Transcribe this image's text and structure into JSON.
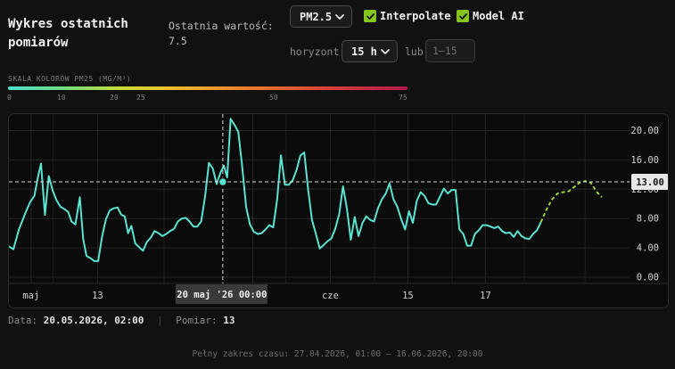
{
  "header": {
    "title": "Wykres ostatnich pomiarów",
    "last_label": "Ostatnia wartość:",
    "last_value": "7.5"
  },
  "controls": {
    "metric": "PM2.5",
    "interpolate_label": "Interpolate",
    "interpolate_checked": true,
    "model_label": "Model AI",
    "model_checked": true,
    "horizon_label": "horyzont",
    "horizon_value": "15 h",
    "or_label": "lub",
    "range_placeholder": "1–15"
  },
  "scale": {
    "title": "SKALA KOLORÓW PM25 (MG/M³)",
    "ticks": [
      "0",
      "10",
      "20",
      "25",
      "50",
      "75"
    ]
  },
  "colors": {
    "line": "#59e3d1",
    "forecast": "#9bd23e",
    "background": "#111111",
    "panel": "#0b0b0b"
  },
  "chart_data": {
    "type": "line",
    "ylim": [
      0,
      22
    ],
    "y_ticks": [
      "0.00",
      "4.00",
      "8.00",
      "12.00",
      "16.00",
      "20.00"
    ],
    "x_labels": [
      {
        "label": "maj",
        "x": 4
      },
      {
        "label": "13",
        "x": 16
      },
      {
        "label": "27",
        "x": 44
      },
      {
        "label": "cze",
        "x": 58
      },
      {
        "label": "15",
        "x": 72
      },
      {
        "label": "17",
        "x": 86
      }
    ],
    "series": [
      {
        "values": [
          [
            0,
            4.2
          ],
          [
            0.8,
            3.8
          ],
          [
            1.8,
            6.5
          ],
          [
            3,
            8.8
          ],
          [
            3.8,
            10.2
          ],
          [
            4.6,
            11.1
          ],
          [
            5.2,
            13.5
          ],
          [
            5.8,
            15.5
          ],
          [
            6.5,
            8.5
          ],
          [
            7.2,
            13.8
          ],
          [
            7.9,
            11.8
          ],
          [
            8.6,
            10.5
          ],
          [
            9.3,
            9.6
          ],
          [
            10,
            9.3
          ],
          [
            10.7,
            8.9
          ],
          [
            11.3,
            7.6
          ],
          [
            12,
            7.2
          ],
          [
            12.8,
            10.9
          ],
          [
            13.4,
            5.2
          ],
          [
            14,
            2.9
          ],
          [
            14.7,
            2.6
          ],
          [
            15.4,
            2.2
          ],
          [
            16.1,
            2.2
          ],
          [
            16.8,
            5.5
          ],
          [
            17.5,
            7.9
          ],
          [
            18.2,
            9.1
          ],
          [
            18.9,
            9.4
          ],
          [
            19.6,
            9.5
          ],
          [
            20.3,
            8.5
          ],
          [
            20.9,
            8.3
          ],
          [
            21.5,
            6
          ],
          [
            22.1,
            7
          ],
          [
            22.8,
            4.6
          ],
          [
            23.5,
            4.1
          ],
          [
            24.2,
            3.6
          ],
          [
            24.9,
            4.8
          ],
          [
            25.6,
            5.4
          ],
          [
            26.3,
            6.3
          ],
          [
            27,
            6
          ],
          [
            27.7,
            5.6
          ],
          [
            28.4,
            5.9
          ],
          [
            29.1,
            6.3
          ],
          [
            29.8,
            6.6
          ],
          [
            30.5,
            7.6
          ],
          [
            31.2,
            8
          ],
          [
            31.9,
            8.1
          ],
          [
            32.6,
            7.6
          ],
          [
            33.3,
            6.9
          ],
          [
            34,
            6.9
          ],
          [
            34.7,
            7.6
          ],
          [
            35.4,
            11
          ],
          [
            36.1,
            15.6
          ],
          [
            36.8,
            14.8
          ],
          [
            37.5,
            12.7
          ],
          [
            38.2,
            14.3
          ],
          [
            38.8,
            15.2
          ],
          [
            39.4,
            13.6
          ],
          [
            40,
            21.6
          ],
          [
            40.7,
            20.8
          ],
          [
            41.4,
            19.8
          ],
          [
            42.1,
            15.1
          ],
          [
            42.8,
            9.6
          ],
          [
            43.5,
            7.2
          ],
          [
            44.2,
            6.2
          ],
          [
            44.9,
            5.9
          ],
          [
            45.6,
            6
          ],
          [
            46.3,
            6.5
          ],
          [
            47,
            7.1
          ],
          [
            47.7,
            6.8
          ],
          [
            48.4,
            10.6
          ],
          [
            49.1,
            16.6
          ],
          [
            49.8,
            12.6
          ],
          [
            50.5,
            12.6
          ],
          [
            51.2,
            13.2
          ],
          [
            51.9,
            14.6
          ],
          [
            52.6,
            16.6
          ],
          [
            53.3,
            17
          ],
          [
            54,
            11.9
          ],
          [
            54.7,
            7.8
          ],
          [
            55.4,
            5.9
          ],
          [
            56.1,
            3.9
          ],
          [
            56.8,
            4.4
          ],
          [
            57.5,
            4.9
          ],
          [
            58.2,
            5.3
          ],
          [
            58.9,
            6.6
          ],
          [
            59.6,
            8.6
          ],
          [
            60.3,
            12.4
          ],
          [
            61,
            9.3
          ],
          [
            61.7,
            5.1
          ],
          [
            62.4,
            8.2
          ],
          [
            63.1,
            5.6
          ],
          [
            63.8,
            7.4
          ],
          [
            64.5,
            8.3
          ],
          [
            65.2,
            7.8
          ],
          [
            65.9,
            7.6
          ],
          [
            66.6,
            9.4
          ],
          [
            67.3,
            10.6
          ],
          [
            68,
            11.4
          ],
          [
            68.7,
            12.8
          ],
          [
            69.4,
            10.6
          ],
          [
            70.1,
            9.6
          ],
          [
            70.8,
            7.9
          ],
          [
            71.5,
            6.5
          ],
          [
            72.2,
            9
          ],
          [
            72.9,
            7.4
          ],
          [
            73.6,
            10.4
          ],
          [
            74.3,
            11.6
          ],
          [
            75,
            11.1
          ],
          [
            75.7,
            10.1
          ],
          [
            76.4,
            9.9
          ],
          [
            77.1,
            9.9
          ],
          [
            77.8,
            11
          ],
          [
            78.5,
            12.1
          ],
          [
            79.2,
            11.4
          ],
          [
            79.9,
            11.9
          ],
          [
            80.6,
            11.9
          ],
          [
            81.3,
            6.5
          ],
          [
            82,
            5.9
          ],
          [
            82.7,
            4.3
          ],
          [
            83.4,
            4.3
          ],
          [
            84.1,
            5.9
          ],
          [
            84.8,
            6.4
          ],
          [
            85.5,
            7.1
          ],
          [
            86.2,
            7.1
          ],
          [
            86.9,
            6.9
          ],
          [
            87.6,
            6.7
          ],
          [
            88.3,
            6.9
          ],
          [
            89,
            6.3
          ],
          [
            89.7,
            6
          ],
          [
            90.4,
            6.1
          ],
          [
            91.1,
            5.5
          ],
          [
            91.8,
            6.3
          ],
          [
            92.5,
            5.6
          ],
          [
            93.2,
            5.3
          ],
          [
            93.9,
            5.2
          ],
          [
            94.6,
            5.9
          ],
          [
            95.3,
            6.4
          ],
          [
            96,
            7.5
          ]
        ]
      },
      {
        "values": [
          [
            96,
            7.5
          ],
          [
            97,
            9.2
          ],
          [
            98,
            10.6
          ],
          [
            99,
            11.4
          ],
          [
            100,
            11.6
          ],
          [
            101,
            11.7
          ],
          [
            102,
            12.3
          ],
          [
            103,
            12.9
          ],
          [
            104,
            13.1
          ],
          [
            105,
            12.9
          ],
          [
            106,
            11.7
          ],
          [
            107,
            10.9
          ]
        ]
      }
    ],
    "cursor": {
      "x": 38.6,
      "y": 13.0,
      "x_label": "20 maj '26   00:00",
      "y_label": "13.00"
    }
  },
  "info": {
    "date_label": "Data:",
    "date_value": "20.05.2026, 02:00",
    "measure_label": "Pomiar:",
    "measure_value": "13"
  },
  "footer": "Pełny zakres czasu: 27.04.2026, 01:00 – 16.06.2026, 20:00"
}
